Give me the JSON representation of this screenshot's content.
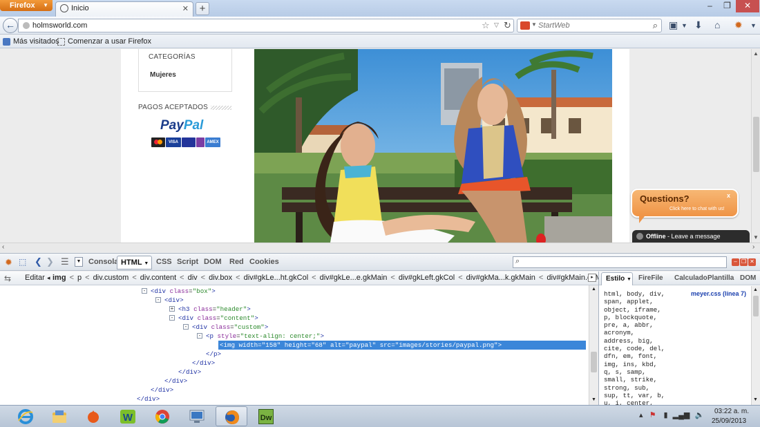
{
  "browser": {
    "menu_label": "Firefox",
    "tab_title": "Inicio",
    "url": "holmsworld.com",
    "search_placeholder": "StartWeb",
    "bookmarks": [
      "Más visitados",
      "Comenzar a usar Firefox"
    ]
  },
  "page": {
    "categories_title": "CATEGORÍAS",
    "category_item": "Mujeres",
    "payments_title": "PAGOS ACEPTADOS",
    "paypal_pay": "Pay",
    "paypal_pal": "Pal",
    "cards": [
      "VISA",
      "AMEX"
    ],
    "chat": {
      "title": "Questions?",
      "subtitle": "Click here to chat with us!",
      "close": "x",
      "offline_label": "Offline",
      "offline_message": " - Leave a message"
    }
  },
  "firebug": {
    "tabs": [
      "Consola",
      "HTML",
      "CSS",
      "Script",
      "DOM",
      "Red",
      "Cookies"
    ],
    "edit_label": "Editar",
    "breadcrumb": [
      "img",
      "p",
      "div.custom",
      "div.content",
      "div",
      "div.box",
      "div#gkLe...ht.gkCol",
      "div#gkLe...e.gkMain",
      "div#gkLeft.gkCol",
      "div#gkMa...k.gkMain",
      "div#gkMain.gkMain"
    ],
    "tree": [
      {
        "indent": 0,
        "toggle": "-",
        "open": "div",
        "attrs": [
          [
            "class",
            "box"
          ]
        ],
        "close": ">"
      },
      {
        "indent": 1,
        "toggle": "-",
        "open": "div",
        "attrs": [],
        "close": ">"
      },
      {
        "indent": 2,
        "toggle": "+",
        "open": "h3",
        "attrs": [
          [
            "class",
            "header"
          ]
        ],
        "close": ">"
      },
      {
        "indent": 2,
        "toggle": "-",
        "open": "div",
        "attrs": [
          [
            "class",
            "content"
          ]
        ],
        "close": ">"
      },
      {
        "indent": 3,
        "toggle": "-",
        "open": "div",
        "attrs": [
          [
            "class",
            "custom"
          ]
        ],
        "close": ">"
      },
      {
        "indent": 4,
        "toggle": "-",
        "open": "p",
        "attrs": [
          [
            "style",
            "text-align: center;"
          ]
        ],
        "close": ">"
      },
      {
        "indent": 5,
        "toggle": "",
        "open": "img",
        "attrs": [
          [
            "width",
            "158"
          ],
          [
            "height",
            "68"
          ],
          [
            "alt",
            "paypal"
          ],
          [
            "src",
            "images/stories/paypal.png"
          ]
        ],
        "close": ">",
        "selected": true
      },
      {
        "indent": 4,
        "toggle": "",
        "end": "p"
      },
      {
        "indent": 3,
        "toggle": "",
        "end": "div"
      },
      {
        "indent": 2,
        "toggle": "",
        "end": "div"
      },
      {
        "indent": 1,
        "toggle": "",
        "end": "div"
      },
      {
        "indent": 0,
        "toggle": "",
        "end": "div"
      },
      {
        "indent": -1,
        "toggle": "",
        "end": "div"
      }
    ],
    "side_tabs": [
      "Estilo",
      "FireFile",
      "Calculado",
      "Plantilla",
      "DOM"
    ],
    "css_rule": "html, body, div,\nspan, applet,\nobject, iframe,\np, blockquote,\npre, a, abbr,\nacronym,\naddress, big,\ncite, code, del,\ndfn, em, font,\nimg, ins, kbd,\nq, s, samp,\nsmall, strike,\nstrong, sub,\nsup, tt, var, b,\nu, i, center,",
    "css_source": "meyer.css (línea 7)"
  },
  "taskbar": {
    "clock_time": "03:22 a. m.",
    "clock_date": "25/09/2013"
  },
  "colors": {
    "firefox_orange": "#e07b21",
    "selection_blue": "#3b86d9",
    "chat_orange": "#ef9446",
    "paypal_dark": "#1a3b8a",
    "paypal_light": "#2a9bd8"
  }
}
